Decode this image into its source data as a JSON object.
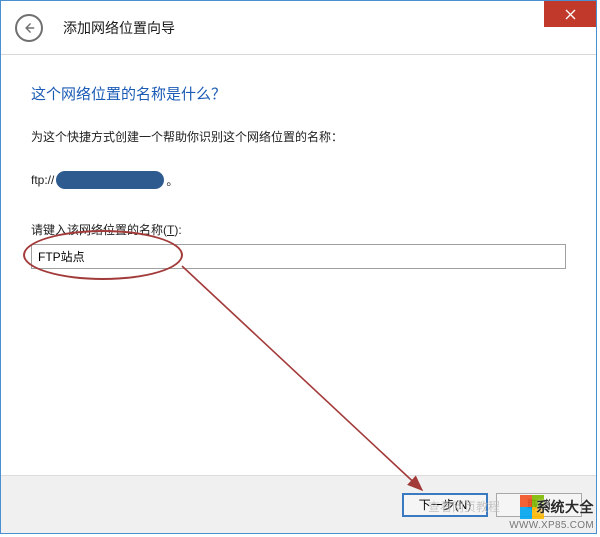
{
  "titlebar": {
    "title": "添加网络位置向导"
  },
  "content": {
    "heading": "这个网络位置的名称是什么？",
    "description": "为这个快捷方式创建一个帮助你识别这个网络位置的名称：",
    "ftp_prefix": "ftp://",
    "ftp_suffix": "。",
    "input_label_pre": "请键入该网络位置的名称(",
    "input_label_key": "T",
    "input_label_post": "):",
    "input_value": "FTP站点"
  },
  "footer": {
    "next_label": "下一步(N)",
    "cancel_label": "取消"
  },
  "watermark": {
    "brand": "系统大全",
    "url": "WWW.XP85.COM",
    "faint": "查看网页教程"
  },
  "icons": {
    "back": "back-arrow-icon",
    "close": "close-icon"
  },
  "colors": {
    "logo_tl": "#f25022",
    "logo_tr": "#7fba00",
    "logo_bl": "#00a4ef",
    "logo_br": "#ffb900"
  }
}
